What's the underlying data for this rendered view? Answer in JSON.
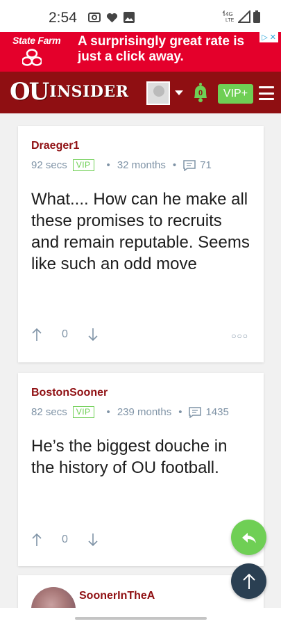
{
  "status_bar": {
    "time": "2:54",
    "network": "4G LTE"
  },
  "ad": {
    "brand": "State Farm",
    "headline": "A surprisingly great rate is just a click away."
  },
  "header": {
    "logo_ou": "OU",
    "logo_insider": "INSIDER",
    "notification_count": "0",
    "vip_label": "VIP+"
  },
  "comments": [
    {
      "username": "Draeger1",
      "time": "92 secs",
      "badge": "VIP",
      "tenure": "32 months",
      "post_count": "71",
      "text": "What.... How can he make all these promises to recruits and remain reputable. Seems like such an odd move",
      "vote_count": "0"
    },
    {
      "username": "BostonSooner",
      "time": "82 secs",
      "badge": "VIP",
      "tenure": "239 months",
      "post_count": "1435",
      "text": "He’s the biggest douche in the history of OU football.",
      "vote_count": "0"
    },
    {
      "username": "SoonerInTheA"
    }
  ],
  "colors": {
    "brand_red": "#8f0f12",
    "vip_green": "#6fcf55",
    "ad_red": "#e4002b",
    "fab_dark": "#2a3f52"
  }
}
